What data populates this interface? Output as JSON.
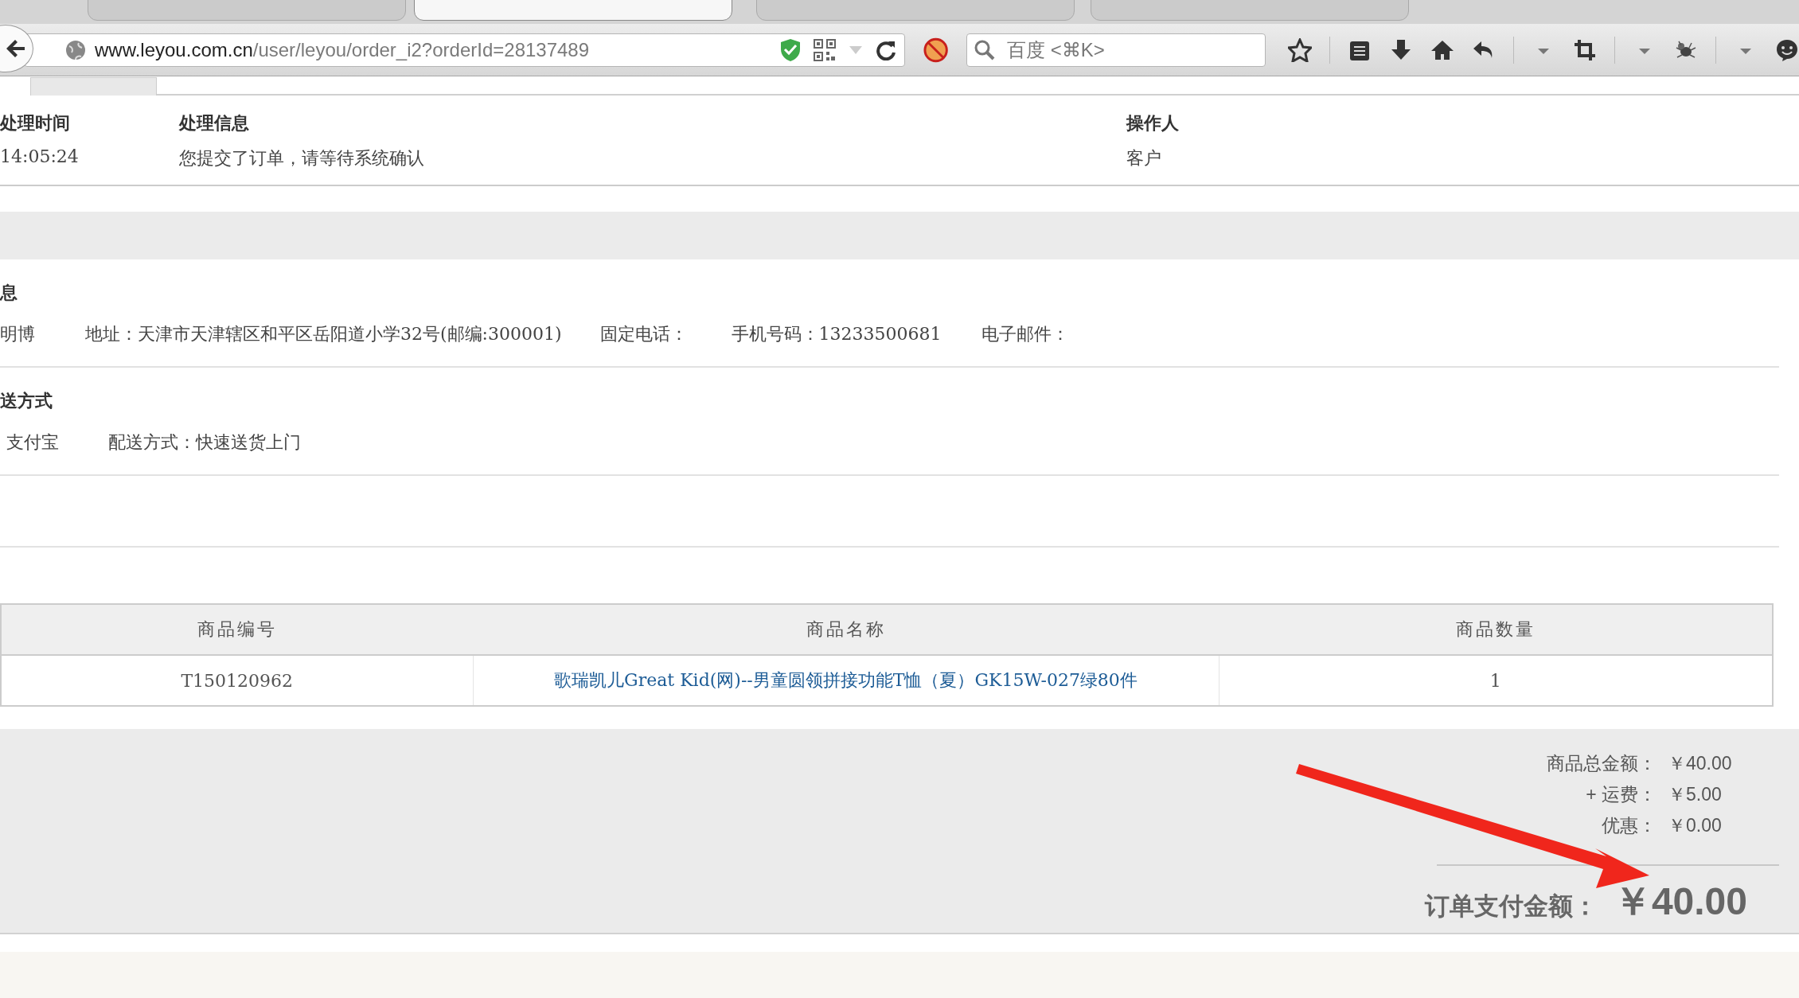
{
  "browser": {
    "tabs": [
      {
        "selected": false
      },
      {
        "selected": true
      },
      {
        "selected": false
      },
      {
        "selected": false
      }
    ],
    "url": {
      "host": "www.leyou.com.cn",
      "path": "/user/leyou/order_i2?orderId=28137489"
    },
    "search_placeholder": "百度 <⌘K>"
  },
  "log": {
    "columns": [
      "处理时间",
      "处理信息",
      "操作人"
    ],
    "rows": [
      [
        "14:05:24",
        "您提交了订单，请等待系统确认",
        "客户"
      ]
    ]
  },
  "receiver": {
    "heading": "息",
    "fields": [
      "明博",
      "地址：天津市天津辖区和平区岳阳道小学32号(邮编:300001)",
      "固定电话：",
      "手机号码：13233500681",
      "电子邮件："
    ]
  },
  "payment": {
    "heading": "送方式",
    "fields": [
      "支付宝",
      "配送方式：快速送货上门"
    ]
  },
  "items": {
    "columns": [
      "商品编号",
      "商品名称",
      "商品数量"
    ],
    "rows": [
      {
        "code": "T150120962",
        "name": "歌瑞凯儿Great Kid(网)--男童圆领拼接功能T恤（夏）GK15W-027绿80件",
        "quantity": "1"
      }
    ]
  },
  "totals": {
    "lines": [
      {
        "label": "商品总金额：",
        "value": "￥40.00"
      },
      {
        "label": "+ 运费：",
        "value": "￥5.00"
      },
      {
        "label": "优惠：",
        "value": "￥0.00"
      }
    ],
    "grand": {
      "label": "订单支付金额：",
      "value": "￥40.00"
    }
  }
}
